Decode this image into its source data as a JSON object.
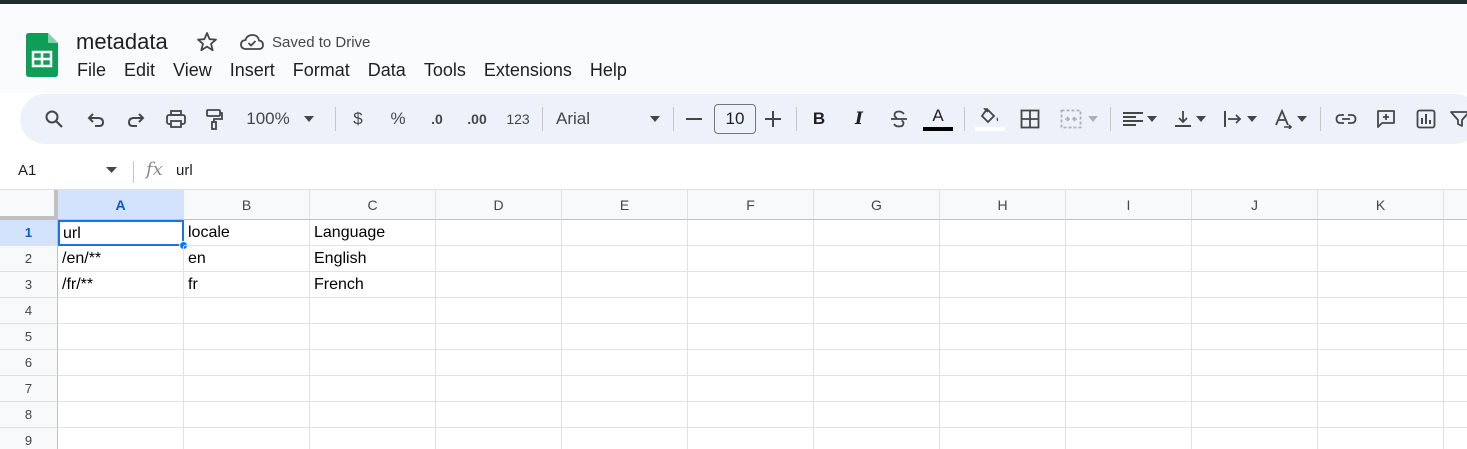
{
  "document": {
    "title": "metadata",
    "save_status": "Saved to Drive"
  },
  "menu": [
    "File",
    "Edit",
    "View",
    "Insert",
    "Format",
    "Data",
    "Tools",
    "Extensions",
    "Help"
  ],
  "toolbar": {
    "zoom": "100%",
    "currency": "$",
    "percent": "%",
    "decrease_decimal": ".0",
    "increase_decimal": ".00",
    "number_format": "123",
    "font": "Arial",
    "font_size": "10",
    "bold": "B",
    "italic": "I",
    "text_color_glyph": "A",
    "text_color": "#000000"
  },
  "formula_bar": {
    "cell_ref": "A1",
    "value": "url"
  },
  "sheet": {
    "columns": [
      "A",
      "B",
      "C",
      "D",
      "E",
      "F",
      "G",
      "H",
      "I",
      "J",
      "K"
    ],
    "row_numbers": [
      "1",
      "2",
      "3",
      "4",
      "5",
      "6",
      "7",
      "8",
      "9"
    ],
    "rows": [
      [
        "url",
        "locale",
        "Language"
      ],
      [
        "/en/**",
        "en",
        "English"
      ],
      [
        "/fr/**",
        "fr",
        "French"
      ]
    ],
    "selected_cell": "A1"
  },
  "colors": {
    "accent": "#1a73e8",
    "sheets_green": "#0f9d58",
    "toolbar_bg": "#edf2fa",
    "selected_header": "#d3e3fd"
  }
}
